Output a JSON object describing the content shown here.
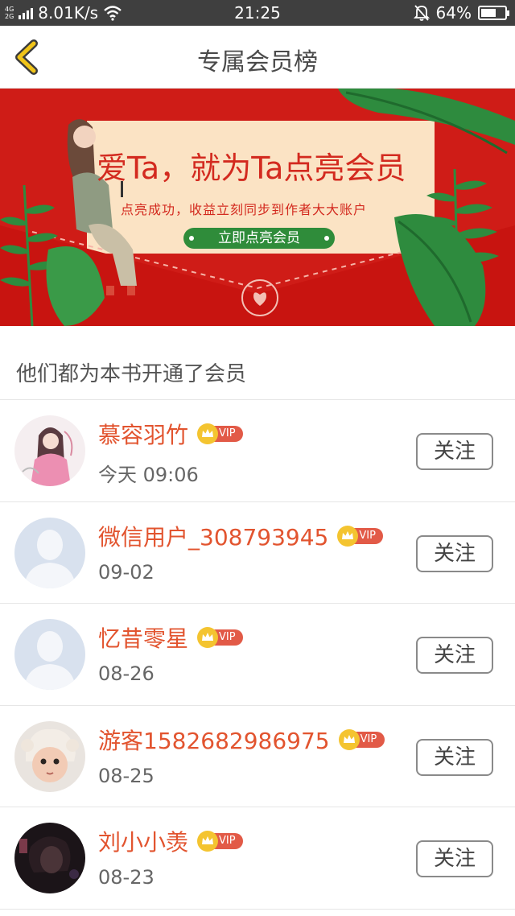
{
  "status_bar": {
    "network_top": "4G",
    "network_bottom": "2G",
    "speed": "8.01K/s",
    "time": "21:25",
    "battery": "64%",
    "battery_level": 0.64,
    "icons": [
      "signal-bars-icon",
      "wifi-icon",
      "alarm-off-icon",
      "battery-icon"
    ]
  },
  "navbar": {
    "back_icon": "chevron-left-icon",
    "title": "专属会员榜"
  },
  "banner": {
    "headline": "爱Ta，就为Ta点亮会员",
    "subline": "点亮成功，收益立刻同步到作者大大账户",
    "cta": "立即点亮会员",
    "colors": {
      "background": "#cf1c17",
      "card": "#fbe3c4",
      "cta": "#2f8c3a",
      "leaf": "#2e8b3e"
    }
  },
  "section": {
    "title": "他们都为本书开通了会员"
  },
  "members": [
    {
      "name": "慕容羽竹",
      "badge": "VIP",
      "time": "今天 09:06",
      "follow": "关注",
      "avatar": "illustrated-woman"
    },
    {
      "name": "微信用户_308793945",
      "badge": "VIP",
      "time": "09-02",
      "follow": "关注",
      "avatar": "default-person"
    },
    {
      "name": "忆昔零星",
      "badge": "VIP",
      "time": "08-26",
      "follow": "关注",
      "avatar": "default-person"
    },
    {
      "name": "游客1582682986975",
      "badge": "VIP",
      "time": "08-25",
      "follow": "关注",
      "avatar": "baby-photo"
    },
    {
      "name": "刘小小羡",
      "badge": "VIP",
      "time": "08-23",
      "follow": "关注",
      "avatar": "dark-photo"
    }
  ],
  "colors": {
    "username": "#e2542f",
    "vip_pill": "#e25a47",
    "crown": "#f4c430",
    "back_chevron": "#f0c419",
    "status_bar": "#3f3f3f"
  }
}
